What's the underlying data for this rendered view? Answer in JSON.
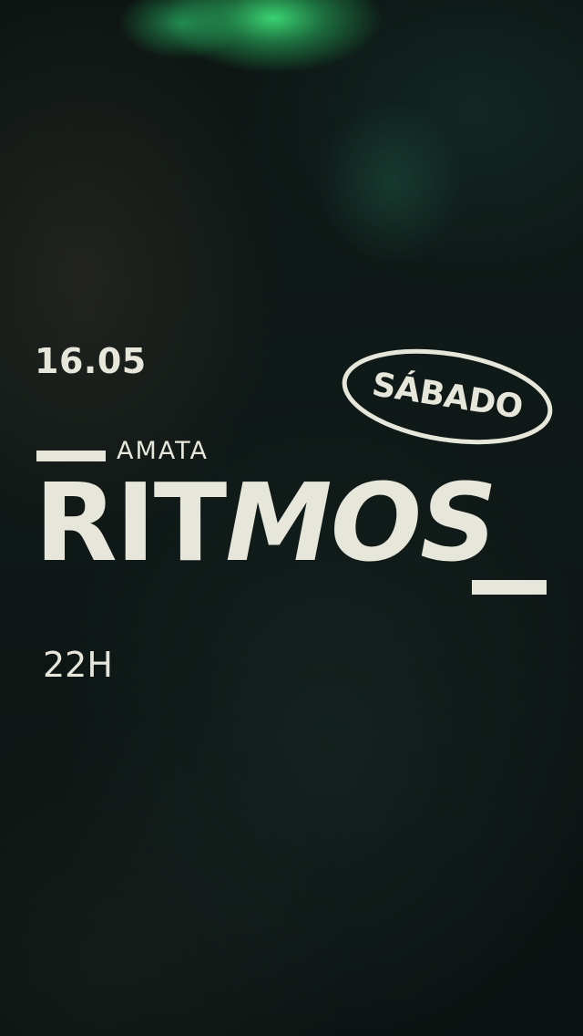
{
  "event": {
    "date": "16.05",
    "day": "SÁBADO",
    "brand_small": "AMATA",
    "title_regular": "RIT",
    "title_italic": "MOS",
    "time": "22H"
  },
  "colors": {
    "text": "#e6e6da",
    "background": "#0f1917",
    "accent_glow": "#3cdc78"
  }
}
